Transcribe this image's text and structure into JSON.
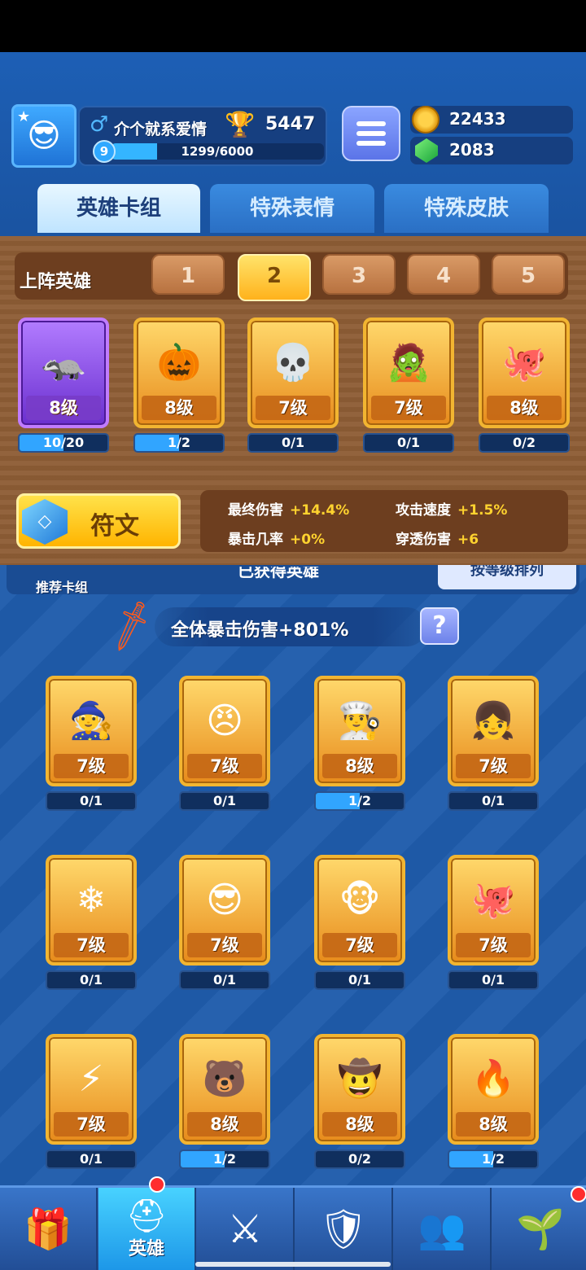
{
  "player": {
    "name": "介个就系爱情",
    "trophies": "5447",
    "level": "9",
    "xp_text": "1299/6000",
    "xp_fraction": 0.2165
  },
  "currency": {
    "coins": "22433",
    "gems": "2083"
  },
  "top_tabs": [
    {
      "label": "英雄卡组",
      "active": true
    },
    {
      "label": "特殊表情",
      "active": false
    },
    {
      "label": "特殊皮肤",
      "active": false
    }
  ],
  "deck": {
    "label": "上阵英雄",
    "tabs": [
      "1",
      "2",
      "3",
      "4",
      "5"
    ],
    "active_tab": "2",
    "heroes": [
      {
        "level": "8级",
        "progress": "10/20",
        "fill": 0.5,
        "frame": "purple",
        "icon": "mole-thief-icon",
        "glyph": "🦡"
      },
      {
        "level": "8级",
        "progress": "1/2",
        "fill": 0.5,
        "frame": "gold",
        "icon": "lantern-hero-icon",
        "glyph": "🎃"
      },
      {
        "level": "7级",
        "progress": "0/1",
        "fill": 0,
        "frame": "gold",
        "icon": "skull-mage-icon",
        "glyph": "💀"
      },
      {
        "level": "7级",
        "progress": "0/1",
        "fill": 0,
        "frame": "gold",
        "icon": "zombie-hero-icon",
        "glyph": "🧟"
      },
      {
        "level": "8级",
        "progress": "0/2",
        "fill": 0,
        "frame": "gold",
        "icon": "pirate-octopus-icon",
        "glyph": "🐙"
      }
    ]
  },
  "rune": {
    "label": "符文",
    "icon_glyph": "◇"
  },
  "stats": [
    {
      "label": "最终伤害",
      "value": "+14.4%"
    },
    {
      "label": "攻击速度",
      "value": "+1.5%"
    },
    {
      "label": "暴击几率",
      "value": "+0%"
    },
    {
      "label": "穿透伤害",
      "value": "+6"
    }
  ],
  "collection": {
    "recommend_label": "推荐卡组",
    "owned_label": "已获得英雄",
    "sort_label": "按等级排列",
    "bonus_text": "全体暴击伤害+801%",
    "help_label": "?",
    "heroes": [
      {
        "level": "7级",
        "progress": "0/1",
        "fill": 0,
        "icon": "hooded-monk-icon",
        "glyph": "🧙"
      },
      {
        "level": "7级",
        "progress": "0/1",
        "fill": 0,
        "icon": "caesar-hero-icon",
        "glyph": "😠"
      },
      {
        "level": "8级",
        "progress": "1/2",
        "fill": 0.5,
        "icon": "chef-hero-icon",
        "glyph": "👨‍🍳"
      },
      {
        "level": "7级",
        "progress": "0/1",
        "fill": 0,
        "icon": "snow-girl-icon",
        "glyph": "👧"
      },
      {
        "level": "7级",
        "progress": "0/1",
        "fill": 0,
        "icon": "yeti-hero-icon",
        "glyph": "❄"
      },
      {
        "level": "7级",
        "progress": "0/1",
        "fill": 0,
        "icon": "police-hero-icon",
        "glyph": "😎"
      },
      {
        "level": "7级",
        "progress": "0/1",
        "fill": 0,
        "icon": "monkey-king-icon",
        "glyph": "🐵"
      },
      {
        "level": "7级",
        "progress": "0/1",
        "fill": 0,
        "icon": "octopus-pirate-icon",
        "glyph": "🐙"
      },
      {
        "level": "7级",
        "progress": "0/1",
        "fill": 0,
        "icon": "zeus-hero-icon",
        "glyph": "⚡"
      },
      {
        "level": "8级",
        "progress": "1/2",
        "fill": 0.5,
        "icon": "ice-bear-icon",
        "glyph": "🐻"
      },
      {
        "level": "8级",
        "progress": "0/2",
        "fill": 0,
        "icon": "cowboy-hero-icon",
        "glyph": "🤠"
      },
      {
        "level": "8级",
        "progress": "1/2",
        "fill": 0.5,
        "icon": "lava-golem-icon",
        "glyph": "🔥"
      }
    ]
  },
  "bottom_nav": [
    {
      "icon": "treasure-chest-icon",
      "glyph": "🎁",
      "label": "",
      "active": false,
      "dot": false
    },
    {
      "icon": "knight-helmet-icon",
      "glyph": "⛑",
      "label": "英雄",
      "active": true,
      "dot": true
    },
    {
      "icon": "crossed-swords-icon",
      "glyph": "⚔",
      "label": "",
      "active": false,
      "dot": false
    },
    {
      "icon": "crown-shield-icon",
      "glyph": "🛡",
      "label": "",
      "active": false,
      "dot": false
    },
    {
      "icon": "social-banner-icon",
      "glyph": "👥",
      "label": "",
      "active": false,
      "dot": false
    },
    {
      "icon": "sprout-island-icon",
      "glyph": "🌱",
      "label": "",
      "active": false,
      "dot": true
    }
  ]
}
